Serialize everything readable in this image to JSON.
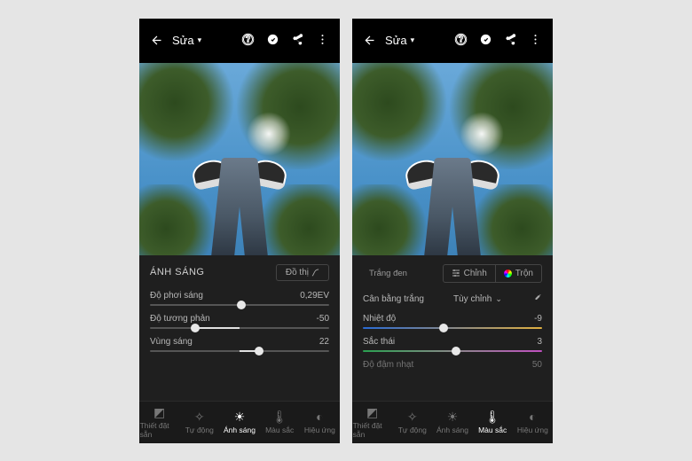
{
  "header": {
    "title": "Sửa"
  },
  "left_panel": {
    "section_title": "ÁNH SÁNG",
    "graph_button": "Đồ thị",
    "sliders": [
      {
        "label": "Độ phơi sáng",
        "value": "0,29EV",
        "pos": 51
      },
      {
        "label": "Độ tương phản",
        "value": "-50",
        "pos": 25,
        "fill_from": 25,
        "fill_to": 50
      },
      {
        "label": "Vùng sáng",
        "value": "22",
        "pos": 61,
        "fill_from": 50,
        "fill_to": 61
      }
    ]
  },
  "right_panel": {
    "bw_label": "Trắng đen",
    "adjust_label": "Chỉnh",
    "mix_label": "Trộn",
    "wb_label": "Cân bằng trắng",
    "wb_mode": "Tùy chỉnh",
    "sliders": [
      {
        "label": "Nhiệt độ",
        "value": "-9",
        "pos": 45,
        "grad": "temp"
      },
      {
        "label": "Sắc thái",
        "value": "3",
        "pos": 52,
        "grad": "tint"
      }
    ],
    "extra_row_label": "Độ đậm nhạt",
    "extra_row_value": "50"
  },
  "tools": [
    {
      "id": "presets",
      "label": "Thiết đặt sẵn"
    },
    {
      "id": "auto",
      "label": "Tự động"
    },
    {
      "id": "light",
      "label": "Ánh sáng"
    },
    {
      "id": "color",
      "label": "Màu sắc"
    },
    {
      "id": "effects",
      "label": "Hiệu ứng"
    }
  ]
}
